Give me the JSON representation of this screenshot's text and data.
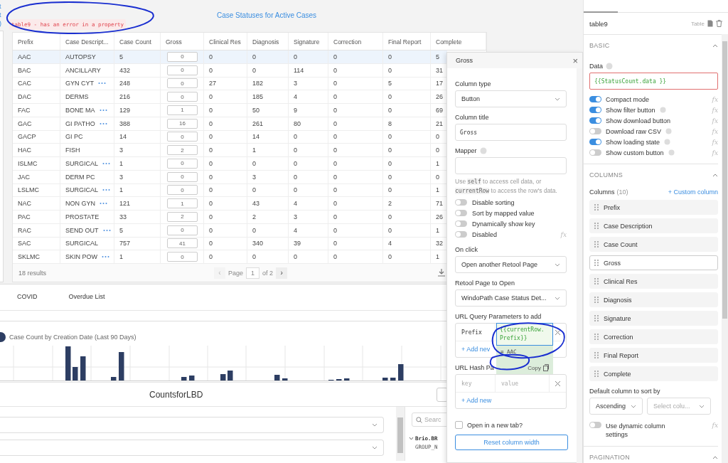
{
  "edge_fragments": [
    "t",
    "t",
    ")"
  ],
  "error_tag": "table9 - has an error in a property",
  "table": {
    "title": "Case Statuses for Active Cases",
    "columns": [
      {
        "label": "Prefix",
        "kind": "text"
      },
      {
        "label": "Case Descript...",
        "kind": "text"
      },
      {
        "label": "Case Count",
        "kind": "text"
      },
      {
        "label": "Gross",
        "kind": "button"
      },
      {
        "label": "Clinical Res",
        "kind": "text"
      },
      {
        "label": "Diagnosis",
        "kind": "text"
      },
      {
        "label": "Signature",
        "kind": "text"
      },
      {
        "label": "Correction",
        "kind": "text"
      },
      {
        "label": "Final Report",
        "kind": "text"
      },
      {
        "label": "Complete",
        "kind": "text"
      }
    ],
    "rows": [
      {
        "selected": true,
        "more": false,
        "cells": [
          "AAC",
          "AUTOPSY",
          "5",
          "0",
          "0",
          "0",
          "0",
          "0",
          "0",
          "5"
        ]
      },
      {
        "selected": false,
        "more": false,
        "cells": [
          "BAC",
          "ANCILLARY",
          "432",
          "0",
          "0",
          "0",
          "114",
          "0",
          "0",
          "31"
        ]
      },
      {
        "selected": false,
        "more": true,
        "cells": [
          "CAC",
          "GYN CYT",
          "248",
          "0",
          "27",
          "182",
          "3",
          "0",
          "5",
          "17"
        ]
      },
      {
        "selected": false,
        "more": false,
        "cells": [
          "DAC",
          "DERMS",
          "216",
          "0",
          "0",
          "185",
          "4",
          "0",
          "0",
          "26"
        ]
      },
      {
        "selected": false,
        "more": true,
        "cells": [
          "FAC",
          "BONE MA",
          "129",
          "1",
          "0",
          "50",
          "9",
          "0",
          "0",
          "69"
        ]
      },
      {
        "selected": false,
        "more": true,
        "cells": [
          "GAC",
          "GI PATHO",
          "388",
          "16",
          "0",
          "261",
          "80",
          "0",
          "8",
          "21"
        ]
      },
      {
        "selected": false,
        "more": false,
        "cells": [
          "GACP",
          "GI PC",
          "14",
          "0",
          "0",
          "14",
          "0",
          "0",
          "0",
          "0"
        ]
      },
      {
        "selected": false,
        "more": false,
        "cells": [
          "HAC",
          "FISH",
          "3",
          "2",
          "0",
          "1",
          "0",
          "0",
          "0",
          "0"
        ]
      },
      {
        "selected": false,
        "more": true,
        "cells": [
          "ISLMC",
          "SURGICAL",
          "1",
          "0",
          "0",
          "0",
          "0",
          "0",
          "0",
          "1"
        ]
      },
      {
        "selected": false,
        "more": false,
        "cells": [
          "JAC",
          "DERM PC",
          "3",
          "0",
          "0",
          "3",
          "0",
          "0",
          "0",
          "0"
        ]
      },
      {
        "selected": false,
        "more": true,
        "cells": [
          "LSLMC",
          "SURGICAL",
          "1",
          "0",
          "0",
          "0",
          "0",
          "0",
          "0",
          "1"
        ]
      },
      {
        "selected": false,
        "more": true,
        "cells": [
          "NAC",
          "NON GYN",
          "121",
          "1",
          "0",
          "43",
          "4",
          "0",
          "2",
          "71"
        ]
      },
      {
        "selected": false,
        "more": false,
        "cells": [
          "PAC",
          "PROSTATE",
          "33",
          "2",
          "0",
          "2",
          "3",
          "0",
          "0",
          "26"
        ]
      },
      {
        "selected": false,
        "more": true,
        "cells": [
          "RAC",
          "SEND OUT",
          "5",
          "0",
          "0",
          "0",
          "4",
          "0",
          "0",
          "1"
        ]
      },
      {
        "selected": false,
        "more": false,
        "cells": [
          "SAC",
          "SURGICAL",
          "757",
          "41",
          "0",
          "340",
          "39",
          "0",
          "4",
          "32"
        ]
      },
      {
        "selected": false,
        "more": true,
        "cells": [
          "SKLMC",
          "SKIN POW",
          "1",
          "0",
          "0",
          "0",
          "0",
          "0",
          "0",
          "1"
        ]
      }
    ],
    "footer": {
      "results": "18 results",
      "prev": "‹",
      "page_label": "Page",
      "page": "1",
      "page_of": "of 2",
      "next": "›"
    }
  },
  "tabs": [
    {
      "label": "COVID",
      "selected": false
    },
    {
      "label": "Overdue List",
      "selected": false
    }
  ],
  "chart": {
    "title": "Case Count by Creation Date (Last 90 Days)"
  },
  "counts_panel": {
    "title": "CountsforLBD",
    "search_placeholder": "Searc",
    "tree": [
      {
        "label": "Brio.BR",
        "expanded": true,
        "children": [
          {
            "label": "GROUP_N"
          }
        ]
      }
    ]
  },
  "column_editor": {
    "title": "Gross",
    "close": "×",
    "column_type": {
      "label": "Column type",
      "value": "Button"
    },
    "column_title": {
      "label": "Column title",
      "value": "Gross"
    },
    "mapper": {
      "label": "Mapper",
      "help": [
        {
          "text": "Use ",
          "code": false
        },
        {
          "text": "self",
          "code": true
        },
        {
          "text": " to access cell data, or ",
          "code": false
        },
        {
          "text": "currentRow",
          "code": true
        },
        {
          "text": " to access the row's data.",
          "code": false
        }
      ]
    },
    "toggles": [
      {
        "label": "Disable sorting",
        "on": false
      },
      {
        "label": "Sort by mapped value",
        "on": false
      },
      {
        "label": "Dynamically show key",
        "on": false
      },
      {
        "label": "Disabled",
        "on": false,
        "fx": "fx"
      }
    ],
    "on_click": {
      "label": "On click",
      "value": "Open another Retool Page"
    },
    "page": {
      "label": "Retool Page to Open",
      "value": "WindoPath Case Status Det..."
    },
    "query_params": {
      "label": "URL Query Parameters to add",
      "rows": [
        {
          "key": "Prefix",
          "value": "{{currentRow.\nPrefix}}"
        }
      ],
      "add": "+ Add nev"
    },
    "eval": {
      "result": "= AAC",
      "copy": "Copy"
    },
    "hash_params": {
      "label": "URL Hash Pa",
      "key_placeholder": "key",
      "value_placeholder": "value",
      "add": "+ Add new"
    },
    "new_tab": {
      "label": "Open in a new tab?",
      "checked": false
    },
    "reset": "Reset column width"
  },
  "inspector": {
    "name": "table9",
    "type": "Table",
    "basic": {
      "title": "BASIC",
      "expanded": true,
      "data_label": "Data",
      "data_value": "{{StatusCount.data }}",
      "data_error": true,
      "toggles": [
        {
          "label": "Compact mode",
          "on": true,
          "help": false,
          "fx": "fx"
        },
        {
          "label": "Show filter button",
          "on": true,
          "help": true,
          "fx": "fx"
        },
        {
          "label": "Show download button",
          "on": true,
          "help": false,
          "fx": "fx"
        },
        {
          "label": "Download raw CSV",
          "on": false,
          "help": true,
          "fx": "fx"
        },
        {
          "label": "Show loading state",
          "on": true,
          "help": true,
          "fx": "fx"
        },
        {
          "label": "Show custom button",
          "on": false,
          "help": true,
          "fx": "fx"
        }
      ]
    },
    "columns": {
      "title": "COLUMNS",
      "expanded": true,
      "label": "Columns",
      "count": "(10)",
      "add": "+ Custom column",
      "items": [
        {
          "label": "Prefix",
          "selected": false
        },
        {
          "label": "Case Description",
          "selected": false
        },
        {
          "label": "Case Count",
          "selected": false
        },
        {
          "label": "Gross",
          "selected": true
        },
        {
          "label": "Clinical Res",
          "selected": false
        },
        {
          "label": "Diagnosis",
          "selected": false
        },
        {
          "label": "Signature",
          "selected": false
        },
        {
          "label": "Correction",
          "selected": false
        },
        {
          "label": "Final Report",
          "selected": false
        },
        {
          "label": "Complete",
          "selected": false
        }
      ],
      "sort_label": "Default column to sort by",
      "sort_order": "Ascending",
      "sort_column_placeholder": "Select colu...",
      "dynamic": {
        "label": "Use dynamic column settings",
        "on": false,
        "fx": "fx"
      }
    },
    "pagination": {
      "title": "PAGINATION",
      "expanded": true
    }
  }
}
